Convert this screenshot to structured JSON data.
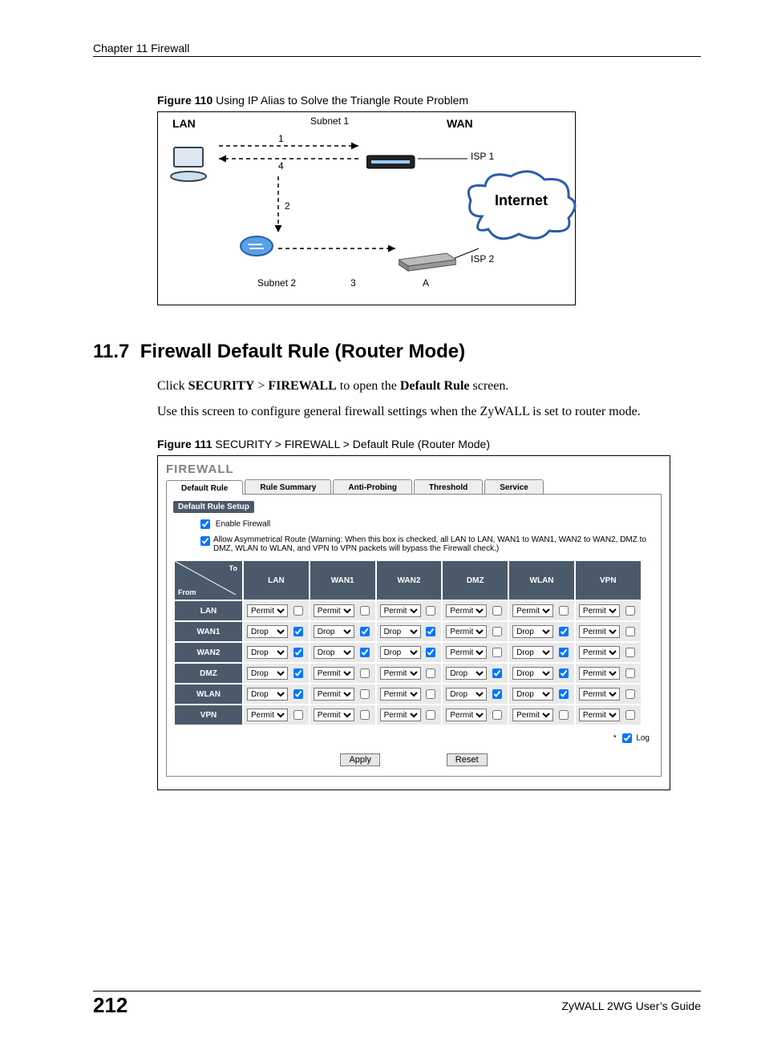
{
  "running_head": "Chapter 11 Firewall",
  "figure110": {
    "caption_bold": "Figure 110",
    "caption_rest": "   Using IP Alias to Solve the Triangle Route Problem",
    "labels": {
      "lan": "LAN",
      "wan": "WAN",
      "subnet1": "Subnet 1",
      "subnet2": "Subnet 2",
      "isp1": "ISP 1",
      "isp2": "ISP 2",
      "internet": "Internet",
      "n1": "1",
      "n2": "2",
      "n3": "3",
      "n4": "4",
      "a": "A"
    }
  },
  "section": {
    "number": "11.7",
    "title": "Firewall Default Rule (Router Mode)"
  },
  "para1_pre": "Click ",
  "para1_b1": "SECURITY",
  "para1_mid": " > ",
  "para1_b2": "FIREWALL",
  "para1_mid2": " to open the ",
  "para1_b3": "Default Rule",
  "para1_post": " screen.",
  "para2": "Use this screen to configure general firewall settings when the ZyWALL is set to router mode.",
  "figure111": {
    "caption_bold": "Figure 111",
    "caption_rest": "   SECURITY > FIREWALL > Default Rule (Router Mode)"
  },
  "shot": {
    "title": "FIREWALL",
    "tabs": [
      "Default Rule",
      "Rule Summary",
      "Anti-Probing",
      "Threshold",
      "Service"
    ],
    "subhead": "Default Rule Setup",
    "enable_label": "Enable Firewall",
    "asym_label": "Allow Asymmetrical Route (Warning: When this box is checked, all LAN to LAN, WAN1 to WAN1, WAN2 to WAN2, DMZ to DMZ, WLAN to WLAN, and VPN to VPN packets will bypass the Firewall check.)",
    "to": "To",
    "from": "From",
    "cols": [
      "LAN",
      "WAN1",
      "WAN2",
      "DMZ",
      "WLAN",
      "VPN"
    ],
    "rows": [
      "LAN",
      "WAN1",
      "WAN2",
      "DMZ",
      "WLAN",
      "VPN"
    ],
    "matrix": [
      [
        {
          "a": "Permit",
          "c": false
        },
        {
          "a": "Permit",
          "c": false
        },
        {
          "a": "Permit",
          "c": false
        },
        {
          "a": "Permit",
          "c": false
        },
        {
          "a": "Permit",
          "c": false
        },
        {
          "a": "Permit",
          "c": false
        }
      ],
      [
        {
          "a": "Drop",
          "c": true
        },
        {
          "a": "Drop",
          "c": true
        },
        {
          "a": "Drop",
          "c": true
        },
        {
          "a": "Permit",
          "c": false
        },
        {
          "a": "Drop",
          "c": true
        },
        {
          "a": "Permit",
          "c": false
        }
      ],
      [
        {
          "a": "Drop",
          "c": true
        },
        {
          "a": "Drop",
          "c": true
        },
        {
          "a": "Drop",
          "c": true
        },
        {
          "a": "Permit",
          "c": false
        },
        {
          "a": "Drop",
          "c": true
        },
        {
          "a": "Permit",
          "c": false
        }
      ],
      [
        {
          "a": "Drop",
          "c": true
        },
        {
          "a": "Permit",
          "c": false
        },
        {
          "a": "Permit",
          "c": false
        },
        {
          "a": "Drop",
          "c": true
        },
        {
          "a": "Drop",
          "c": true
        },
        {
          "a": "Permit",
          "c": false
        }
      ],
      [
        {
          "a": "Drop",
          "c": true
        },
        {
          "a": "Permit",
          "c": false
        },
        {
          "a": "Permit",
          "c": false
        },
        {
          "a": "Drop",
          "c": true
        },
        {
          "a": "Drop",
          "c": true
        },
        {
          "a": "Permit",
          "c": false
        }
      ],
      [
        {
          "a": "Permit",
          "c": false
        },
        {
          "a": "Permit",
          "c": false
        },
        {
          "a": "Permit",
          "c": false
        },
        {
          "a": "Permit",
          "c": false
        },
        {
          "a": "Permit",
          "c": false
        },
        {
          "a": "Permit",
          "c": false
        }
      ]
    ],
    "select_options": [
      "Permit",
      "Drop"
    ],
    "log_star": "*",
    "log_label": "Log",
    "log_checked": true,
    "apply": "Apply",
    "reset": "Reset"
  },
  "footer": {
    "page": "212",
    "guide": "ZyWALL 2WG User’s Guide"
  }
}
